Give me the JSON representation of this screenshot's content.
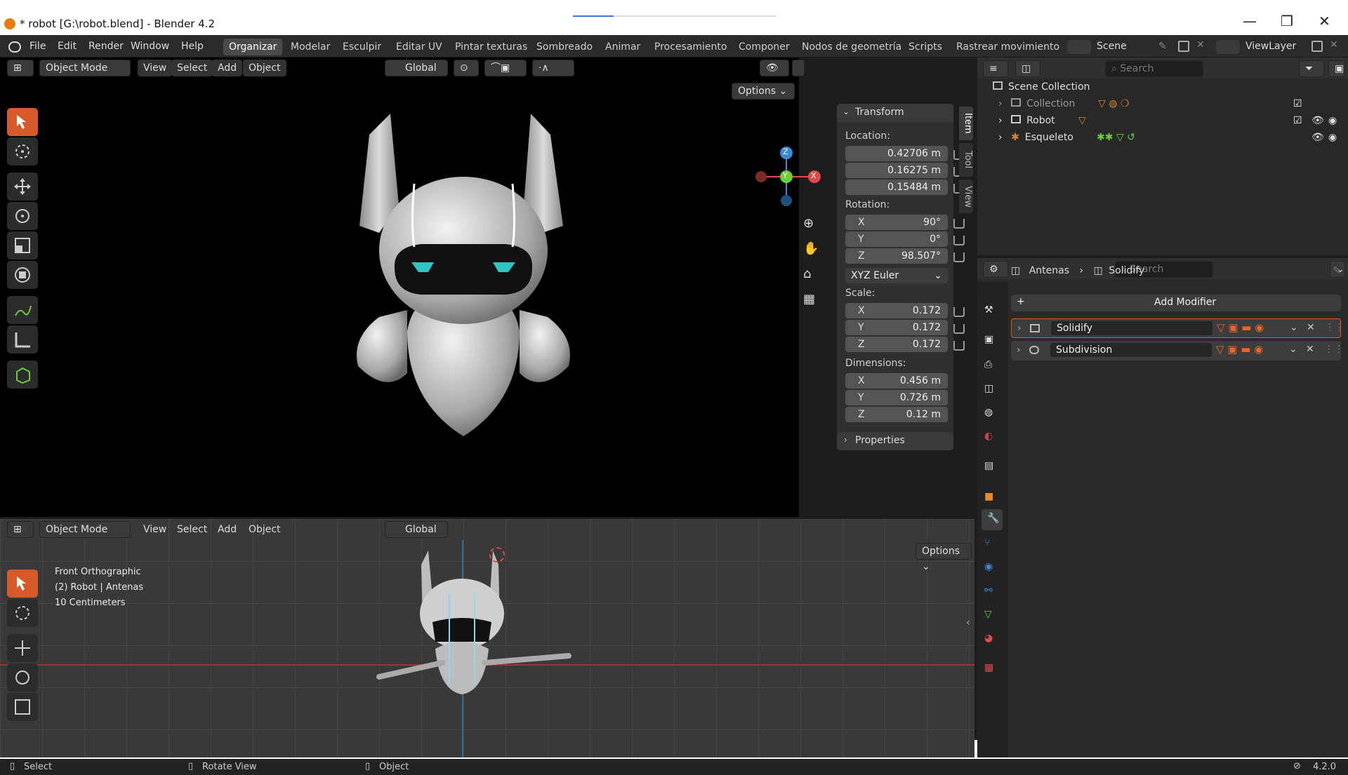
{
  "window": {
    "title": "* robot [G:\\robot.blend] - Blender 4.2",
    "minimize": "—",
    "maximize": "❐",
    "close": "✕"
  },
  "menu": [
    "File",
    "Edit",
    "Render",
    "Window",
    "Help"
  ],
  "workspaces": [
    "Organizar",
    "Modelar",
    "Esculpir",
    "Editar UV",
    "Pintar texturas",
    "Sombreado",
    "Animar",
    "Procesamiento",
    "Componer",
    "Nodos de geometría",
    "Scripts",
    "Rastrear movimiento"
  ],
  "scene": {
    "label": "Scene",
    "viewlayer": "ViewLayer"
  },
  "viewport_top": {
    "mode": "Object Mode",
    "menus": [
      "View",
      "Select",
      "Add",
      "Object"
    ],
    "orientation": "Global",
    "options": "Options"
  },
  "viewport_bottom": {
    "mode": "Object Mode",
    "menus": [
      "View",
      "Select",
      "Add",
      "Object"
    ],
    "orientation": "Global",
    "options": "Options",
    "overlay": [
      "Front Orthographic",
      "(2) Robot | Antenas",
      "10 Centimeters"
    ]
  },
  "gizmo": {
    "z": "Z",
    "y": "Y",
    "x": "X"
  },
  "transform": {
    "header": "Transform",
    "location_label": "Location:",
    "location": [
      "0.42706 m",
      "0.16275 m",
      "0.15484 m"
    ],
    "rotation_label": "Rotation:",
    "rotation": [
      {
        "a": "X",
        "v": "90°"
      },
      {
        "a": "Y",
        "v": "0°"
      },
      {
        "a": "Z",
        "v": "98.507°"
      }
    ],
    "rotation_mode": "XYZ Euler",
    "scale_label": "Scale:",
    "scale": [
      {
        "a": "X",
        "v": "0.172"
      },
      {
        "a": "Y",
        "v": "0.172"
      },
      {
        "a": "Z",
        "v": "0.172"
      }
    ],
    "dimensions_label": "Dimensions:",
    "dimensions": [
      {
        "a": "X",
        "v": "0.456 m"
      },
      {
        "a": "Y",
        "v": "0.726 m"
      },
      {
        "a": "Z",
        "v": "0.12 m"
      }
    ],
    "properties": "Properties"
  },
  "side_tabs": [
    "Item",
    "Tool",
    "View"
  ],
  "outliner": {
    "search": "Search",
    "root": "Scene Collection",
    "items": [
      "Collection",
      "Robot",
      "Esqueleto"
    ]
  },
  "properties_editor": {
    "search": "Search",
    "breadcrumb": [
      "Antenas",
      "Solidify"
    ],
    "add_modifier": "Add Modifier",
    "modifiers": [
      "Solidify",
      "Subdivision"
    ]
  },
  "statusbar": {
    "select": "Select",
    "rotate": "Rotate View",
    "object": "Object",
    "version": "4.2.0"
  },
  "colors": {
    "accent": "#d75a2a",
    "axis_x": "#e04a4a",
    "axis_y": "#6ccc3c",
    "axis_z": "#3a8ad8",
    "background": "#1d1d1d"
  }
}
